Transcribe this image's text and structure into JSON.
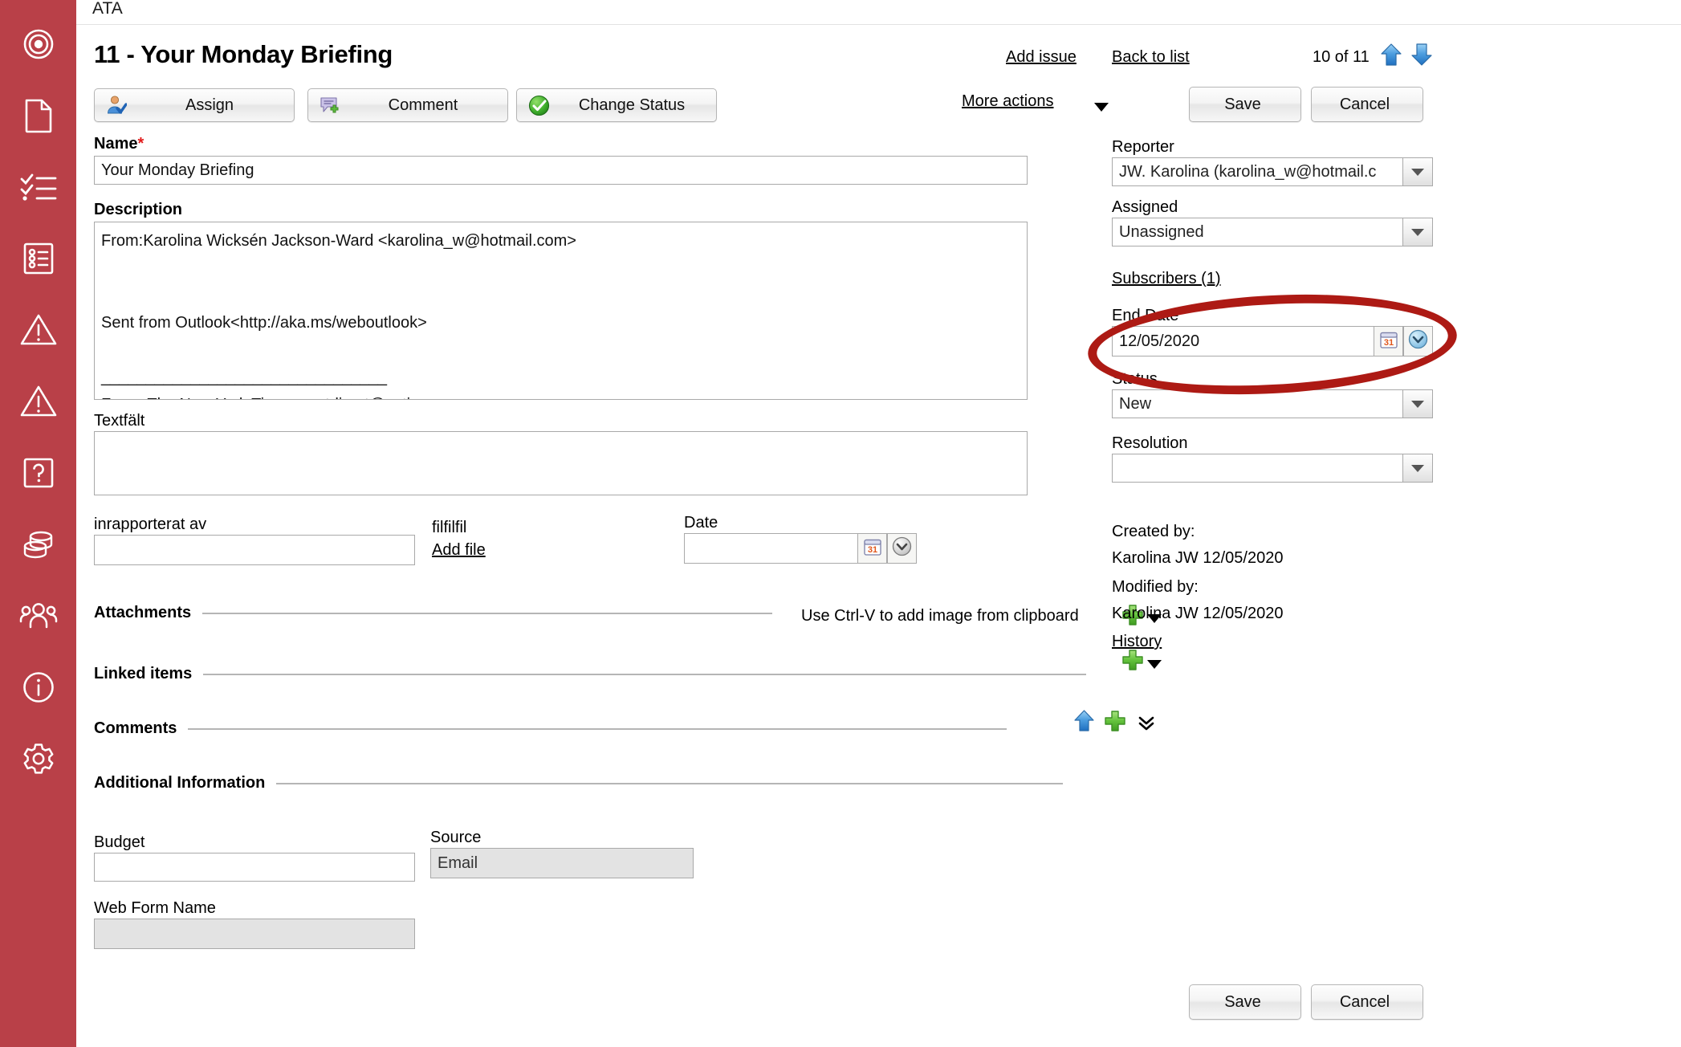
{
  "app": {
    "topbar_label": "ATA"
  },
  "sidebar": {
    "bg": "#b94048",
    "items": [
      {
        "name": "target-icon",
        "label": "Target"
      },
      {
        "name": "document-icon",
        "label": "Document"
      },
      {
        "name": "checklist-icon",
        "label": "Checklist"
      },
      {
        "name": "form-list-icon",
        "label": "Form list"
      },
      {
        "name": "warning-icon",
        "label": "Warning"
      },
      {
        "name": "warning-alt-icon",
        "label": "Warning"
      },
      {
        "name": "question-icon",
        "label": "Help"
      },
      {
        "name": "database-icon",
        "label": "Database"
      },
      {
        "name": "users-icon",
        "label": "Users"
      },
      {
        "name": "info-icon",
        "label": "Info"
      },
      {
        "name": "gear-icon",
        "label": "Settings"
      }
    ]
  },
  "header": {
    "title": "11 - Your Monday Briefing",
    "add_issue": "Add issue",
    "back_to_list": "Back to list",
    "pager": "10 of 11",
    "more_actions": "More actions",
    "save": "Save",
    "cancel": "Cancel"
  },
  "toolbar": {
    "assign": "Assign",
    "comment": "Comment",
    "change_status": "Change Status"
  },
  "form": {
    "name_label": "Name",
    "name_required": "*",
    "name_value": "Your Monday Briefing",
    "description_label": "Description",
    "description_value": "From:Karolina Wicksén Jackson-Ward <karolina_w@hotmail.com>\n\n\nSent from Outlook<http://aka.ms/weboutlook>\n\n________________________________\nFrom: The New York Times <nytdirect@nytimes.com>",
    "textfalt_label": "Textfält",
    "textfalt_value": "",
    "inrapporterat_label": "inrapporterat av",
    "inrapporterat_value": "",
    "filfilfil_label": "filfilfil",
    "add_file_link": "Add file",
    "date_label": "Date",
    "date_value": ""
  },
  "sections": {
    "attachments": "Attachments",
    "attachments_hint": "Use Ctrl-V to add image from clipboard",
    "linked_items": "Linked items",
    "comments": "Comments",
    "additional_information": "Additional Information"
  },
  "additional": {
    "budget_label": "Budget",
    "budget_value": "",
    "source_label": "Source",
    "source_value": "Email",
    "web_form_label": "Web Form Name",
    "web_form_value": ""
  },
  "details": {
    "reporter_label": "Reporter",
    "reporter_value": "JW. Karolina (karolina_w@hotmail.c",
    "assigned_label": "Assigned",
    "assigned_value": "Unassigned",
    "subscribers_label": "Subscribers (1)",
    "end_date_label": "End Date",
    "end_date_value": "12/05/2020",
    "status_label": "Status",
    "status_value": "New",
    "resolution_label": "Resolution",
    "resolution_value": "",
    "created_by_label": "Created by:",
    "created_by_value": "Karolina JW 12/05/2020",
    "modified_by_label": "Modified by:",
    "modified_by_value": "Karolina JW 12/05/2020",
    "history_link": "History"
  },
  "footer": {
    "save": "Save",
    "cancel": "Cancel"
  },
  "annotation": {
    "color": "#ad1a14",
    "target": "end-date-field"
  }
}
